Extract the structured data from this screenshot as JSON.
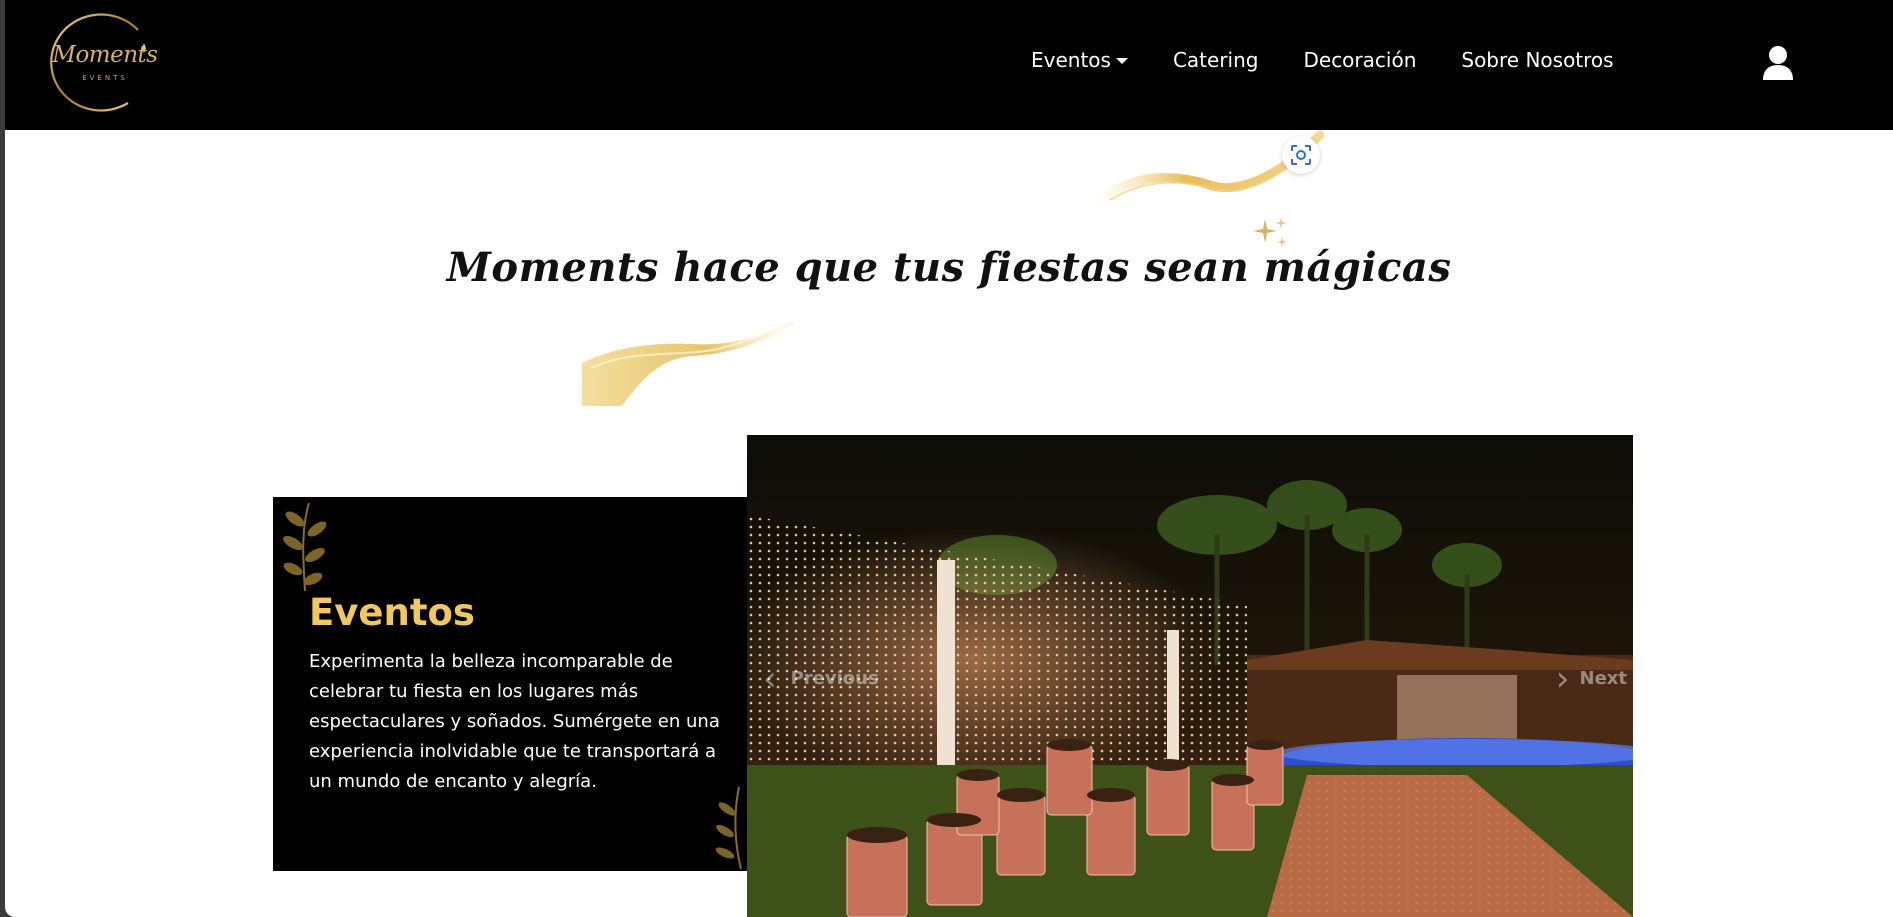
{
  "brand": {
    "logo_script": "Moments",
    "logo_sub": "EVENTS"
  },
  "nav": {
    "items": [
      {
        "label": "Eventos",
        "has_dropdown": true
      },
      {
        "label": "Catering",
        "has_dropdown": false
      },
      {
        "label": "Decoración",
        "has_dropdown": false
      },
      {
        "label": "Sobre Nosotros",
        "has_dropdown": false
      }
    ],
    "user_icon": "user-icon"
  },
  "hero": {
    "title": "Moments hace que tus fiestas sean mágicas",
    "lens_icon": "visual-search-icon"
  },
  "section": {
    "title": "Eventos",
    "text": "Experimenta la belleza incomparable de celebrar tu fiesta en los lugares más espectaculares y soñados. Sumérgete en una experiencia inolvidable que te transportará a un mundo de encanto y alegría."
  },
  "carousel": {
    "prev_label": "Previous",
    "next_label": "Next"
  },
  "colors": {
    "navbar_bg": "#000000",
    "accent_gold": "#f1c75f",
    "page_bg": "#ffffff"
  }
}
